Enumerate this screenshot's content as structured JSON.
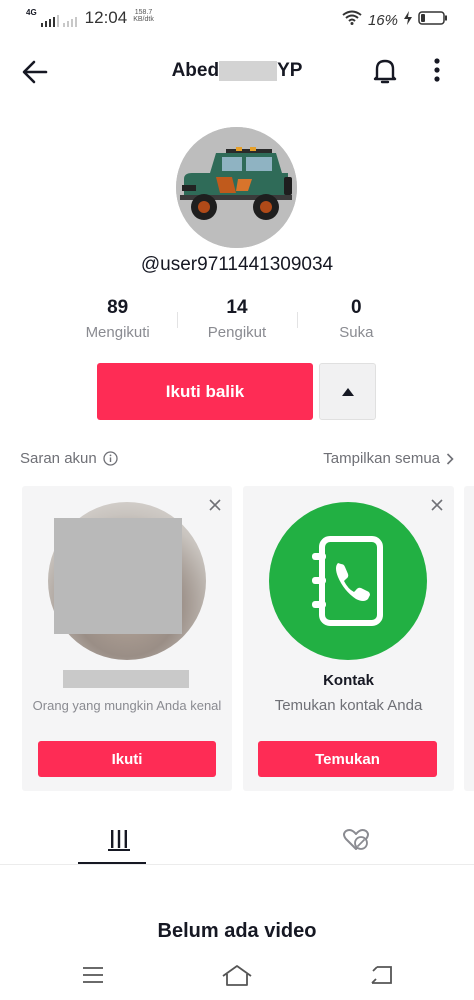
{
  "status_bar": {
    "network": "4G",
    "time": "12:04",
    "speed_value": "158.7",
    "speed_unit": "KB/dtk",
    "battery": "16%"
  },
  "header": {
    "title_start": "Abed",
    "title_end": "YP"
  },
  "profile": {
    "username": "@user9711441309034"
  },
  "stats": [
    {
      "value": "89",
      "label": "Mengikuti"
    },
    {
      "value": "14",
      "label": "Pengikut"
    },
    {
      "value": "0",
      "label": "Suka"
    }
  ],
  "actions": {
    "follow_back_label": "Ikuti balik"
  },
  "suggestions": {
    "heading": "Saran akun",
    "show_all": "Tampilkan semua",
    "cards": [
      {
        "reason": "Orang yang mungkin Anda kenal",
        "button": "Ikuti"
      },
      {
        "title": "Kontak",
        "subtitle": "Temukan kontak Anda",
        "button": "Temukan"
      }
    ]
  },
  "empty_state": "Belum ada video",
  "colors": {
    "accent": "#fe2c55",
    "contact_green": "#22b043"
  }
}
